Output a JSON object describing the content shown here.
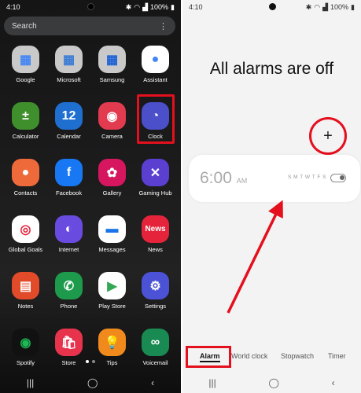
{
  "left": {
    "status": {
      "time": "4:10",
      "battery": "100%"
    },
    "search": {
      "placeholder": "Search",
      "menu": "⋮"
    },
    "apps": [
      {
        "label": "Google",
        "icon": "google-folder-icon",
        "bg": "#c9c9c9",
        "glyph": "▦",
        "fg": "#4285f4"
      },
      {
        "label": "Microsoft",
        "icon": "microsoft-folder-icon",
        "bg": "#c9c9c9",
        "glyph": "▦",
        "fg": "#3a7bd5"
      },
      {
        "label": "Samsung",
        "icon": "samsung-folder-icon",
        "bg": "#c9c9c9",
        "glyph": "▦",
        "fg": "#1a5fd6"
      },
      {
        "label": "Assistant",
        "icon": "assistant-icon",
        "bg": "#ffffff",
        "glyph": "●",
        "fg": "#4285f4"
      },
      {
        "label": "Calculator",
        "icon": "calculator-icon",
        "bg": "#3f8f2c",
        "glyph": "±",
        "fg": "#fff"
      },
      {
        "label": "Calendar",
        "icon": "calendar-icon",
        "bg": "#1f6fd1",
        "glyph": "12",
        "fg": "#fff"
      },
      {
        "label": "Camera",
        "icon": "camera-icon",
        "bg": "#e23a4f",
        "glyph": "◉",
        "fg": "#fff"
      },
      {
        "label": "Clock",
        "icon": "clock-icon",
        "bg": "#4b4fc9",
        "glyph": "◔",
        "fg": "#fff"
      },
      {
        "label": "Contacts",
        "icon": "contacts-icon",
        "bg": "#ee6a3a",
        "glyph": "●",
        "fg": "#fff"
      },
      {
        "label": "Facebook",
        "icon": "facebook-icon",
        "bg": "#1877f2",
        "glyph": "f",
        "fg": "#fff"
      },
      {
        "label": "Gallery",
        "icon": "gallery-icon",
        "bg": "#d6175f",
        "glyph": "✿",
        "fg": "#fff"
      },
      {
        "label": "Gaming Hub",
        "icon": "gaming-hub-icon",
        "bg": "#5b3fd1",
        "glyph": "✕",
        "fg": "#fff"
      },
      {
        "label": "Global Goals",
        "icon": "global-goals-icon",
        "bg": "#ffffff",
        "glyph": "◎",
        "fg": "#e5243b"
      },
      {
        "label": "Internet",
        "icon": "internet-icon",
        "bg": "#6a4be0",
        "glyph": "◐",
        "fg": "#fff"
      },
      {
        "label": "Messages",
        "icon": "messages-icon",
        "bg": "#ffffff",
        "glyph": "▬",
        "fg": "#1a73e8"
      },
      {
        "label": "News",
        "icon": "news-icon",
        "bg": "#e5243b",
        "glyph": "News",
        "fg": "#fff"
      },
      {
        "label": "Notes",
        "icon": "notes-icon",
        "bg": "#e14b2a",
        "glyph": "▤",
        "fg": "#fff"
      },
      {
        "label": "Phone",
        "icon": "phone-icon",
        "bg": "#1d9a4b",
        "glyph": "✆",
        "fg": "#fff"
      },
      {
        "label": "Play Store",
        "icon": "play-store-icon",
        "bg": "#ffffff",
        "glyph": "▶",
        "fg": "#34a853"
      },
      {
        "label": "Settings",
        "icon": "settings-icon",
        "bg": "#4b52d6",
        "glyph": "⚙",
        "fg": "#fff"
      },
      {
        "label": "Spotify",
        "icon": "spotify-icon",
        "bg": "#111111",
        "glyph": "◉",
        "fg": "#1db954"
      },
      {
        "label": "Store",
        "icon": "store-icon",
        "bg": "#e8334d",
        "glyph": "🛍",
        "fg": "#fff"
      },
      {
        "label": "Tips",
        "icon": "tips-icon",
        "bg": "#f08a1c",
        "glyph": "💡",
        "fg": "#fff"
      },
      {
        "label": "Voicemail",
        "icon": "voicemail-icon",
        "bg": "#1a8a53",
        "glyph": "∞",
        "fg": "#fff"
      }
    ],
    "nav": {
      "recents": "|||",
      "home": "◯",
      "back": "‹"
    }
  },
  "right": {
    "status": {
      "time": "4:10",
      "battery": "100%"
    },
    "title": "All alarms are off",
    "add_button": "+",
    "alarm": {
      "time": "6:00",
      "ampm": "AM",
      "days": "S M T W T F S",
      "enabled": false
    },
    "tabs": {
      "alarm": "Alarm",
      "world_clock": "World clock",
      "stopwatch": "Stopwatch",
      "timer": "Timer"
    },
    "nav": {
      "recents": "|||",
      "home": "◯",
      "back": "‹"
    }
  },
  "colors": {
    "highlight": "#e4101e"
  }
}
